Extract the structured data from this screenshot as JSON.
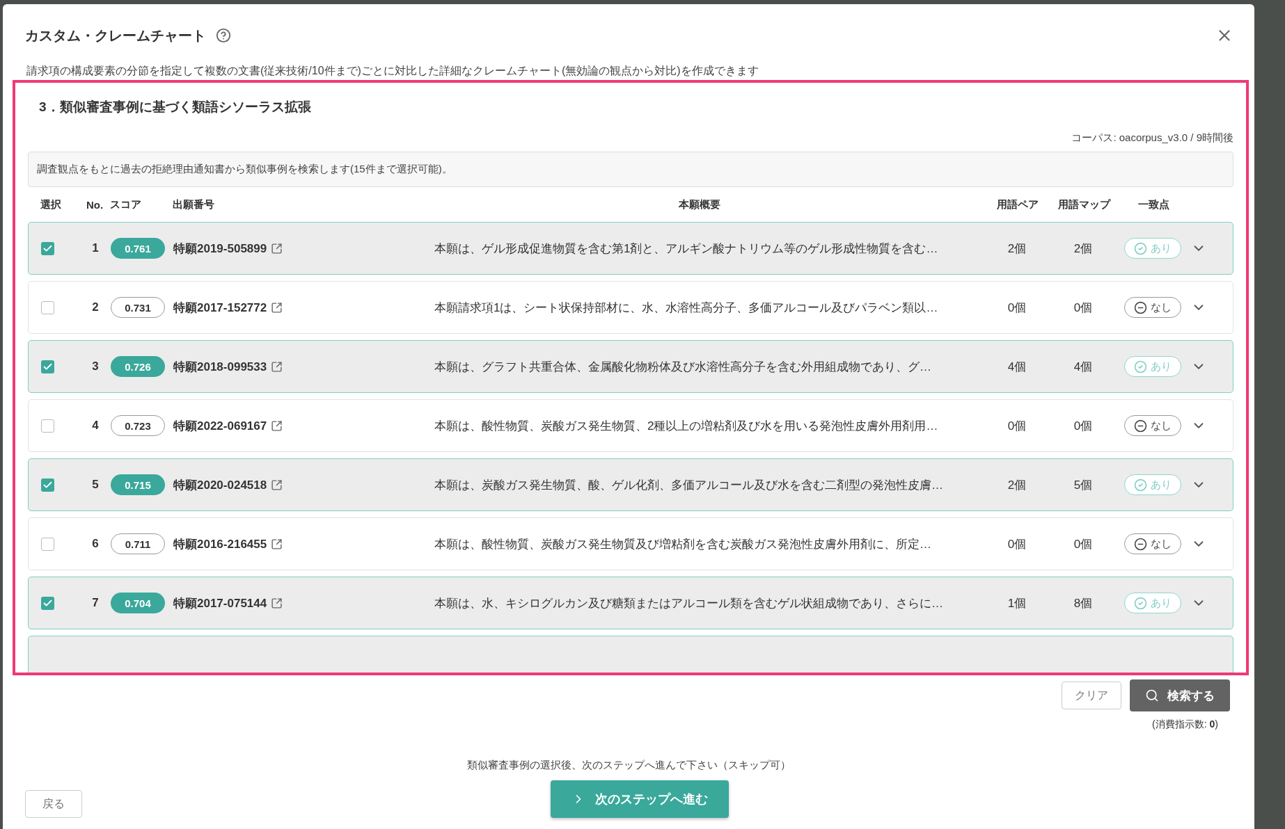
{
  "dialog": {
    "title": "カスタム・クレームチャート",
    "description": "請求項の構成要素の分節を指定して複数の文書(従来技術/10件まで)ごとに対比した詳細なクレームチャート(無効論の観点から対比)を作成できます"
  },
  "section": {
    "highlighted": true,
    "title": "3．類似審査事例に基づく類語シソーラス拡張",
    "corpus": "コーパス: oacorpus_v3.0 / 9時間後",
    "notice": "調査観点をもとに過去の拒絶理由通知書から類似事例を検索します(15件まで選択可能)。"
  },
  "table": {
    "columns": [
      "選択",
      "No.",
      "スコア",
      "出願番号",
      "本願概要",
      "用語ペア",
      "用語マップ",
      "一致点"
    ],
    "rows": [
      {
        "checked": true,
        "no": "1",
        "score": "0.761",
        "application": "特願2019-505899",
        "summary": "本願は、ゲル形成促進物質を含む第1剤と、アルギン酸ナトリウム等のゲル形成性物質を含む…",
        "term_pairs": "2個",
        "term_maps": "2個",
        "match": {
          "kind": "yes",
          "label": "あり"
        }
      },
      {
        "checked": false,
        "no": "2",
        "score": "0.731",
        "application": "特願2017-152772",
        "summary": "本願請求項1は、シート状保持部材に、水、水溶性高分子、多価アルコール及びパラベン類以…",
        "term_pairs": "0個",
        "term_maps": "0個",
        "match": {
          "kind": "no",
          "label": "なし"
        }
      },
      {
        "checked": true,
        "no": "3",
        "score": "0.726",
        "application": "特願2018-099533",
        "summary": "本願は、グラフト共重合体、金属酸化物粉体及び水溶性高分子を含む外用組成物であり、グ…",
        "term_pairs": "4個",
        "term_maps": "4個",
        "match": {
          "kind": "yes",
          "label": "あり"
        }
      },
      {
        "checked": false,
        "no": "4",
        "score": "0.723",
        "application": "特願2022-069167",
        "summary": "本願は、酸性物質、炭酸ガス発生物質、2種以上の増粘剤及び水を用いる発泡性皮膚外用剤用…",
        "term_pairs": "0個",
        "term_maps": "0個",
        "match": {
          "kind": "no",
          "label": "なし"
        }
      },
      {
        "checked": true,
        "no": "5",
        "score": "0.715",
        "application": "特願2020-024518",
        "summary": "本願は、炭酸ガス発生物質、酸、ゲル化剤、多価アルコール及び水を含む二剤型の発泡性皮膚…",
        "term_pairs": "2個",
        "term_maps": "5個",
        "match": {
          "kind": "yes",
          "label": "あり"
        }
      },
      {
        "checked": false,
        "no": "6",
        "score": "0.711",
        "application": "特願2016-216455",
        "summary": "本願は、酸性物質、炭酸ガス発生物質及び増粘剤を含む炭酸ガス発泡性皮膚外用剤に、所定…",
        "term_pairs": "0個",
        "term_maps": "0個",
        "match": {
          "kind": "no",
          "label": "なし"
        }
      },
      {
        "checked": true,
        "no": "7",
        "score": "0.704",
        "application": "特願2017-075144",
        "summary": "本願は、水、キシログルカン及び糖類またはアルコール類を含むゲル状組成物であり、さらに…",
        "term_pairs": "1個",
        "term_maps": "8個",
        "match": {
          "kind": "yes",
          "label": "あり"
        }
      }
    ]
  },
  "search_bar": {
    "clear": "クリア",
    "search": "検索する",
    "usage": "(消費指示数: **0**)"
  },
  "footer": {
    "hint": "類似審査事例の選択後、次のステップへ進んで下さい（スキップ可）",
    "back": "戻る",
    "next": "次のステップへ進む"
  }
}
